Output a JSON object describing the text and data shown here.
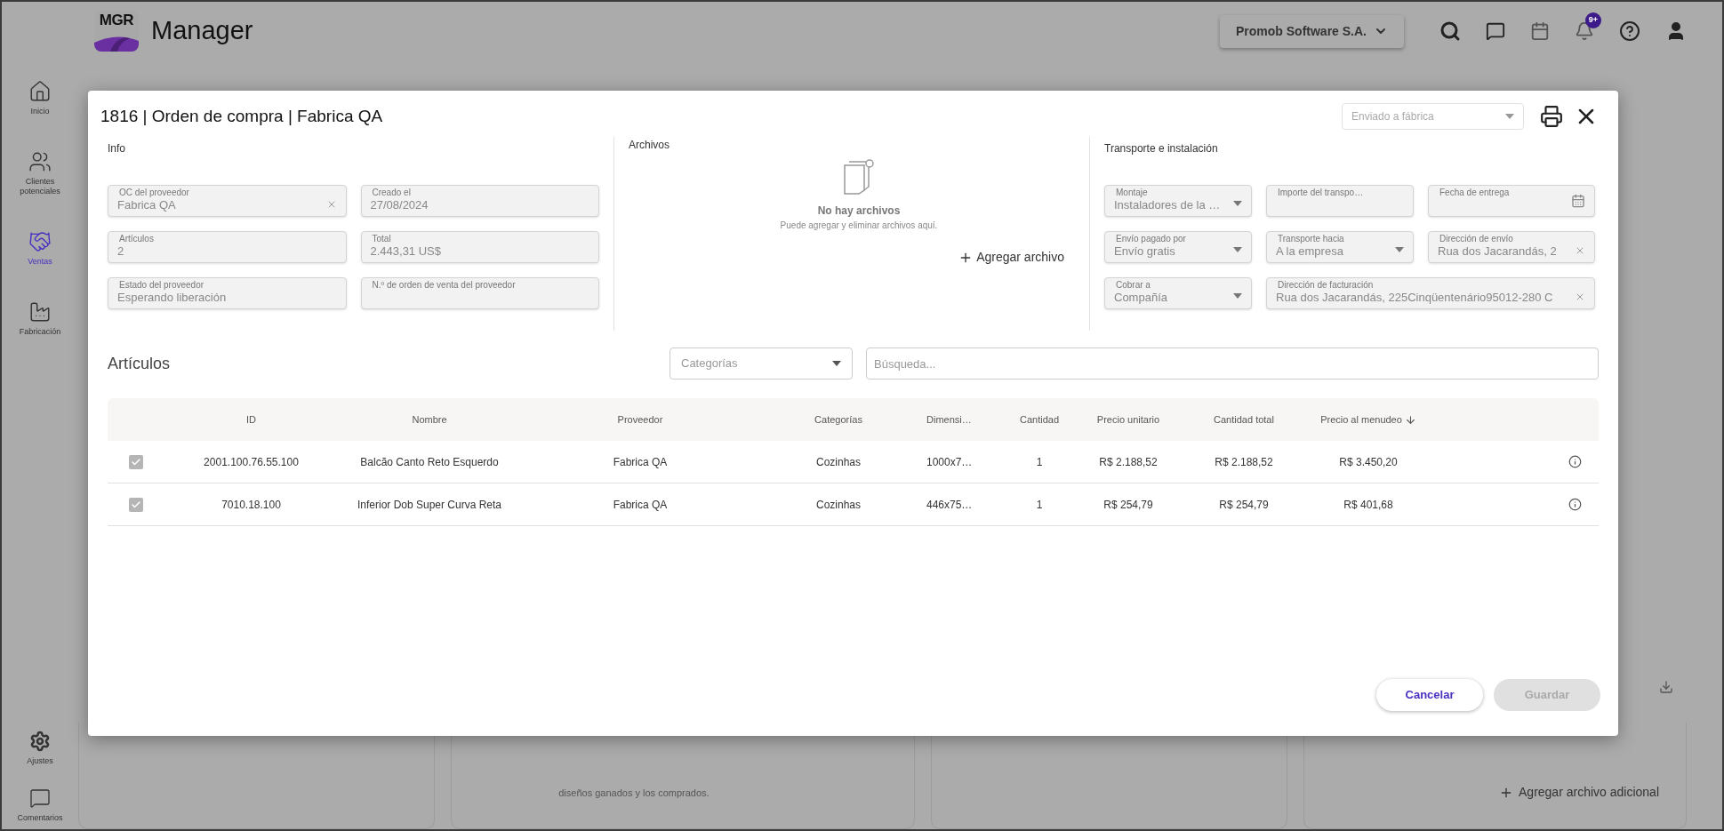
{
  "header": {
    "logo": "MGR",
    "title": "Manager",
    "company": "Promob Software S.A.",
    "notification_count": "9+"
  },
  "sidebar": {
    "items": [
      {
        "label": "Inicio",
        "selected": false
      },
      {
        "label": "Clientes potenciales",
        "selected": false
      },
      {
        "label": "Ventas",
        "selected": true
      },
      {
        "label": "Fabricación",
        "selected": false
      }
    ],
    "bottom_items": [
      {
        "label": "Ajustes"
      },
      {
        "label": "Comentarios"
      }
    ]
  },
  "background": {
    "caption": "diseños ganados y los comprados.",
    "add_button": "Agregar archivo adicional"
  },
  "modal": {
    "title": "1816 | Orden de compra | Fabrica QA",
    "status": {
      "placeholder": "Enviado a fábrica"
    },
    "info": {
      "title": "Info",
      "fields": [
        {
          "label": "OC del proveedor",
          "value": "Fabrica QA",
          "kind": "clearable"
        },
        {
          "label": "Creado el",
          "value": "27/08/2024",
          "kind": "text"
        },
        {
          "label": "Artículos",
          "value": "2",
          "kind": "text"
        },
        {
          "label": "Total",
          "value": "2.443,31 US$",
          "kind": "text"
        },
        {
          "label": "Estado del proveedor",
          "value": "Esperando liberación",
          "kind": "text"
        },
        {
          "label": "N.º de orden de venta del proveedor",
          "kind": "text"
        }
      ]
    },
    "files": {
      "title": "Archivos",
      "empty_title": "No hay archivos",
      "empty_text": "Puede agregar y eliminar archivos aquí.",
      "add_button": "Agregar archivo"
    },
    "transport": {
      "title": "Transporte e instalación",
      "fields": [
        {
          "label": "Montaje",
          "value": "Instaladores de la …",
          "kind": "select"
        },
        {
          "label": "Importe del transpo…",
          "kind": "text"
        },
        {
          "label": "Fecha de entrega",
          "kind": "date"
        },
        {
          "label": "Envío pagado por",
          "value": "Envío gratis",
          "kind": "select"
        },
        {
          "label": "Transporte hacia",
          "value": "A la empresa",
          "kind": "select"
        },
        {
          "label": "Dirección de envío",
          "value": "Rua dos Jacarandás, 2",
          "kind": "clearable"
        },
        {
          "label": "Cobrar a",
          "value": "Compañía",
          "kind": "select"
        },
        {
          "label": "Dirección de facturación",
          "value": "Rua dos Jacarandás, 225Cinqüentenário95012-280 C",
          "kind": "clearable"
        }
      ]
    },
    "articles": {
      "title": "Artículos",
      "category_filter": {
        "placeholder": "Categorías"
      },
      "search": {
        "placeholder": "Búsqueda..."
      },
      "table": {
        "columns": [
          {
            "label": "ID"
          },
          {
            "label": "Nombre"
          },
          {
            "label": "Proveedor"
          },
          {
            "label": "Categorías"
          },
          {
            "label": "Dimensi…"
          },
          {
            "label": "Cantidad"
          },
          {
            "label": "Precio unitario"
          },
          {
            "label": "Cantidad total"
          },
          {
            "label": "Precio al menudeo",
            "sorted": true
          }
        ],
        "rows": [
          {
            "checked": true,
            "cells": [
              "2001.100.76.55.100",
              "Balcão Canto Reto Esquerdo",
              "Fabrica QA",
              "Cozinhas",
              "1000x7…",
              "1",
              "R$ 2.188,52",
              "R$ 2.188,52",
              "R$ 3.450,20"
            ]
          },
          {
            "checked": true,
            "cells": [
              "7010.18.100",
              "Inferior Dob Super Curva Reta",
              "Fabrica QA",
              "Cozinhas",
              "446x75…",
              "1",
              "R$ 254,79",
              "R$ 254,79",
              "R$ 401,68"
            ]
          }
        ]
      }
    },
    "buttons": [
      {
        "label": "Cancelar",
        "disabled": false
      },
      {
        "label": "Guardar",
        "disabled": true
      }
    ]
  }
}
